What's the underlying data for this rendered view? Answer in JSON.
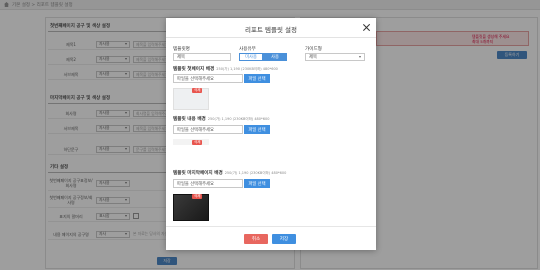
{
  "background": {
    "breadcrumb": "기본 설정 > 리포트 템플릿 설정",
    "section1_title": "첫번째페이지 공구 및 색상 설정",
    "section2_title": "마지막페이지 공구 및 색상 설정",
    "section3_title": "기타 설정",
    "rows1": [
      {
        "label": "제목1",
        "select": "자사용",
        "input": "제목을 입력해주세요"
      },
      {
        "label": "제목2",
        "select": "자사용",
        "input": "제목을 입력해주세요"
      },
      {
        "label": "서브제목",
        "select": "자사용",
        "input": "제목을 입력해주세요"
      }
    ],
    "rows2": [
      {
        "label": "회사명",
        "select": "자사용",
        "input": "회사명을 입력해주세요"
      },
      {
        "label": "서브제목",
        "select": "자사용",
        "input": "제목을 입력해주세요"
      },
      {
        "label": "하단문구",
        "select": "자사용",
        "input": "문구를 입력해주세요"
      }
    ],
    "rows3": [
      {
        "label": "첫번째페이지 공구표정보/회사명",
        "select": "자사용"
      },
      {
        "label": "첫번째페이지 공구정보/회사명",
        "select": "자사용"
      },
      {
        "label": "표지의 말머리",
        "select": "표시함",
        "color": "#ffffff"
      },
      {
        "label": "내용 페이지의 공구명",
        "select": "자사",
        "hint": "본 자료는 당사의 자산이므로 무단배포를 금합니다"
      }
    ],
    "save_label": "저장",
    "alert_text": [
      "템플릿을 생성해 주세요",
      "최대 5개까지"
    ],
    "right_button": "등록하기"
  },
  "modal": {
    "title": "리포트 템플릿 설정",
    "name_label": "템플릿명",
    "name_value": "제목",
    "usage_label": "사용유무",
    "usage_off": "미사용",
    "usage_on": "사용",
    "type_label": "가이드형",
    "type_value": "제목",
    "cover_label": "템플릿 첫페이지 배경",
    "cover_hint": "250(가) 1,190 (230KB이하) 480*600",
    "inner_label": "템플릿 내용 배경",
    "inner_hint": "250(가) 1,190 (230KB이하) 480*600",
    "last_label": "템플릿 마지막페이지 배경",
    "last_hint": "250(가) 1,190 (230KB이하) 480*600",
    "file_placeholder": "파일을 선택해주세요",
    "file_button": "파일 선택",
    "delete_badge": "삭제",
    "cancel_label": "취소",
    "save_label": "저장"
  }
}
